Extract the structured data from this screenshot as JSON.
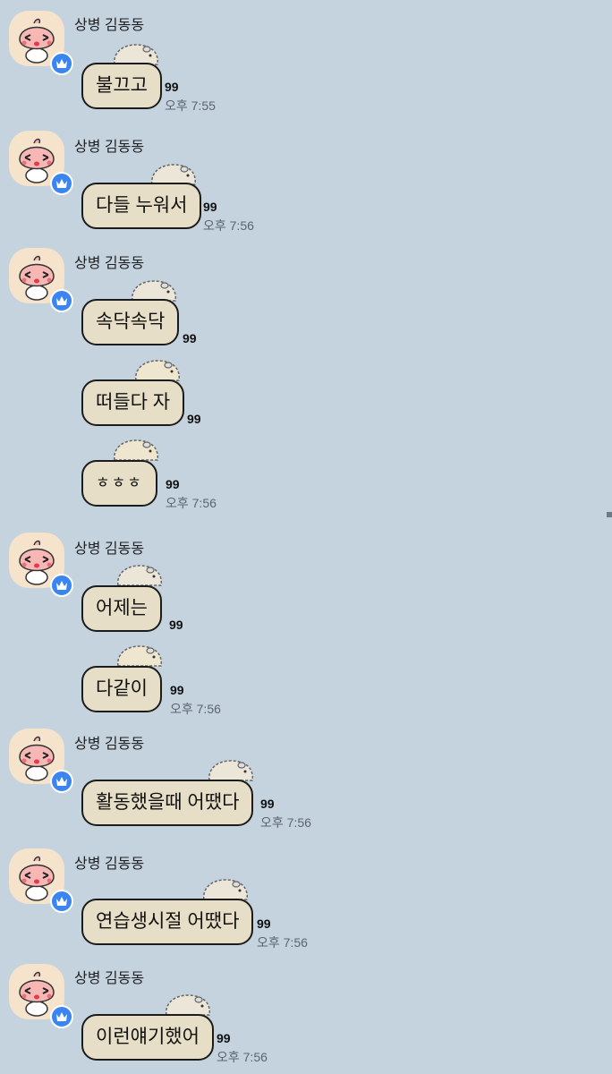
{
  "chat": {
    "sender_name": "상병 김동동",
    "messages": [
      {
        "text": "불끄고",
        "count": "99",
        "time": "오후 7:55"
      },
      {
        "text": "다들 누워서",
        "count": "99",
        "time": "오후 7:56"
      },
      {
        "text": "속닥속닥",
        "count": "99",
        "time": ""
      },
      {
        "text": "떠들다 자",
        "count": "99",
        "time": ""
      },
      {
        "text": "ㅎㅎㅎ",
        "count": "99",
        "time": "오후 7:56"
      },
      {
        "text": "어제는",
        "count": "99",
        "time": ""
      },
      {
        "text": "다같이",
        "count": "99",
        "time": "오후 7:56"
      },
      {
        "text": "활동했을때 어땠다",
        "count": "99",
        "time": "오후 7:56"
      },
      {
        "text": "연습생시절 어땠다",
        "count": "99",
        "time": "오후 7:56"
      },
      {
        "text": "이런얘기했어",
        "count": "99",
        "time": "오후 7:56"
      }
    ]
  },
  "colors": {
    "background": "#c5d3df",
    "bubble_fill": "#e6dec6",
    "bubble_border": "#1c1c1c",
    "badge": "#3b85f1"
  },
  "icons": {
    "avatar": "peach-character-icon",
    "badge": "crown-icon",
    "sticker": "hamster-sticker-icon"
  }
}
